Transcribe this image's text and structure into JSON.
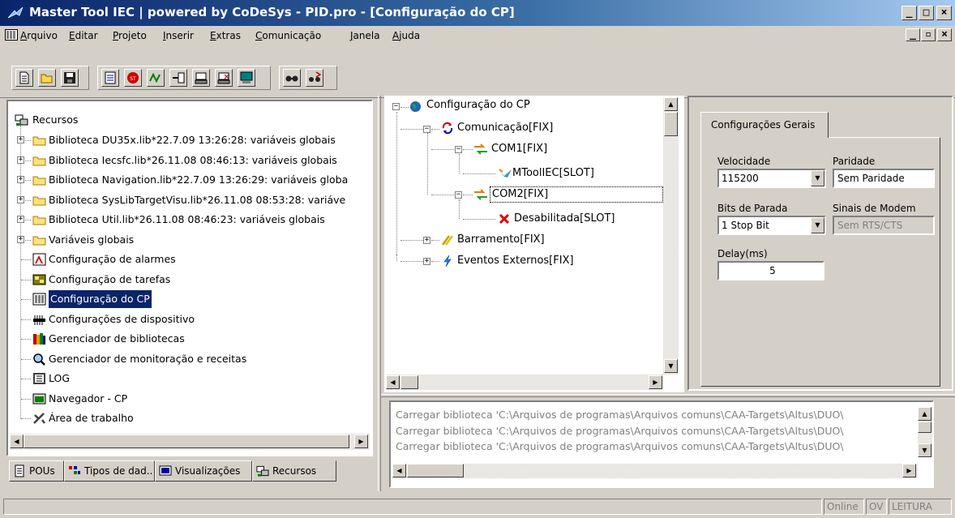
{
  "window": {
    "title": "Master Tool IEC | powered by CoDeSys - PID.pro - [Configuração do CP]",
    "caption_buttons": [
      "_",
      "□",
      "×"
    ],
    "mdi_buttons": [
      "_",
      "▫",
      "×"
    ]
  },
  "menu": {
    "items": [
      "Arquivo",
      "Editar",
      "Projeto",
      "Inserir",
      "Extras",
      "Comunicação",
      "Janela",
      "Ajuda"
    ]
  },
  "toolbar": {
    "buttons": [
      "new-icon",
      "open-icon",
      "save-icon",
      "compile-icon",
      "stop-icon",
      "run-icon",
      "download-icon",
      "login-icon",
      "logout-icon",
      "debug-icon",
      "find-icon",
      "replace-icon"
    ]
  },
  "resources": {
    "root_label": "Recursos",
    "items": [
      {
        "label": "Biblioteca DU35x.lib*22.7.09 13:26:28: variáveis globais",
        "icon": "folder-icon",
        "expandable": true
      },
      {
        "label": "Biblioteca Iecsfc.lib*26.11.08 08:46:13: variáveis globais",
        "icon": "folder-icon",
        "expandable": true
      },
      {
        "label": "Biblioteca Navigation.lib*22.7.09 13:26:29: variáveis globa",
        "icon": "folder-icon",
        "expandable": true
      },
      {
        "label": "Biblioteca SysLibTargetVisu.lib*26.11.08 08:53:28: variáve",
        "icon": "folder-icon",
        "expandable": true
      },
      {
        "label": "Biblioteca Util.lib*26.11.08 08:46:23: variáveis globais",
        "icon": "folder-icon",
        "expandable": true
      },
      {
        "label": "Variáveis globais",
        "icon": "folder-icon",
        "expandable": true
      },
      {
        "label": "Configuração de alarmes",
        "icon": "alarm-icon",
        "expandable": false
      },
      {
        "label": "Configuração de tarefas",
        "icon": "tasks-icon",
        "expandable": false
      },
      {
        "label": "Configuração do CP",
        "icon": "plc-config-icon",
        "expandable": false,
        "selected": true
      },
      {
        "label": "Configurações de dispositivo",
        "icon": "device-icon",
        "expandable": false
      },
      {
        "label": "Gerenciador de bibliotecas",
        "icon": "library-icon",
        "expandable": false
      },
      {
        "label": "Gerenciador de monitoração e receitas",
        "icon": "watch-icon",
        "expandable": false
      },
      {
        "label": "LOG",
        "icon": "log-icon",
        "expandable": false
      },
      {
        "label": "Navegador - CP",
        "icon": "browser-icon",
        "expandable": false
      },
      {
        "label": "Área de trabalho",
        "icon": "workspace-icon",
        "expandable": false
      }
    ]
  },
  "bottom_tabs": [
    {
      "label": "POUs",
      "icon": "pou-icon"
    },
    {
      "label": "Tipos de dad..",
      "icon": "datatype-icon"
    },
    {
      "label": "Visualizações",
      "icon": "visualization-icon"
    },
    {
      "label": "Recursos",
      "icon": "resources-icon",
      "active": true
    }
  ],
  "plc_tree": {
    "root": "Configuração do CP",
    "communication": "Comunicação[FIX]",
    "com1": "COM1[FIX]",
    "com1_child": "MToolIEC[SLOT]",
    "com2": "COM2[FIX]",
    "com2_child": "Desabilitada[SLOT]",
    "bus": "Barramento[FIX]",
    "events": "Eventos Externos[FIX]"
  },
  "config": {
    "tab_label": "Configurações Gerais",
    "speed_label": "Velocidade",
    "speed_value": "115200",
    "parity_label": "Paridade",
    "parity_value": "Sem Paridade",
    "stopbits_label": "Bits de Parada",
    "stopbits_value": "1 Stop Bit",
    "modem_label": "Sinais de Modem",
    "modem_value": "Sem RTS/CTS",
    "delay_label": "Delay(ms)",
    "delay_value": "5"
  },
  "log": {
    "lines": [
      "Carregar biblioteca 'C:\\Arquivos de programas\\Arquivos comuns\\CAA-Targets\\Altus\\DUO\\",
      "Carregar biblioteca 'C:\\Arquivos de programas\\Arquivos comuns\\CAA-Targets\\Altus\\DUO\\",
      "Carregar biblioteca 'C:\\Arquivos de programas\\Arquivos comuns\\CAA-Targets\\Altus\\DUO\\"
    ]
  },
  "status": {
    "online": "Online",
    "ov": "OV",
    "mode": "LEITURA"
  },
  "colors": {
    "title_gradient_start": "#0a246a",
    "title_gradient_end": "#a6caf0",
    "selection": "#0a246a",
    "face": "#d4d0c8"
  }
}
